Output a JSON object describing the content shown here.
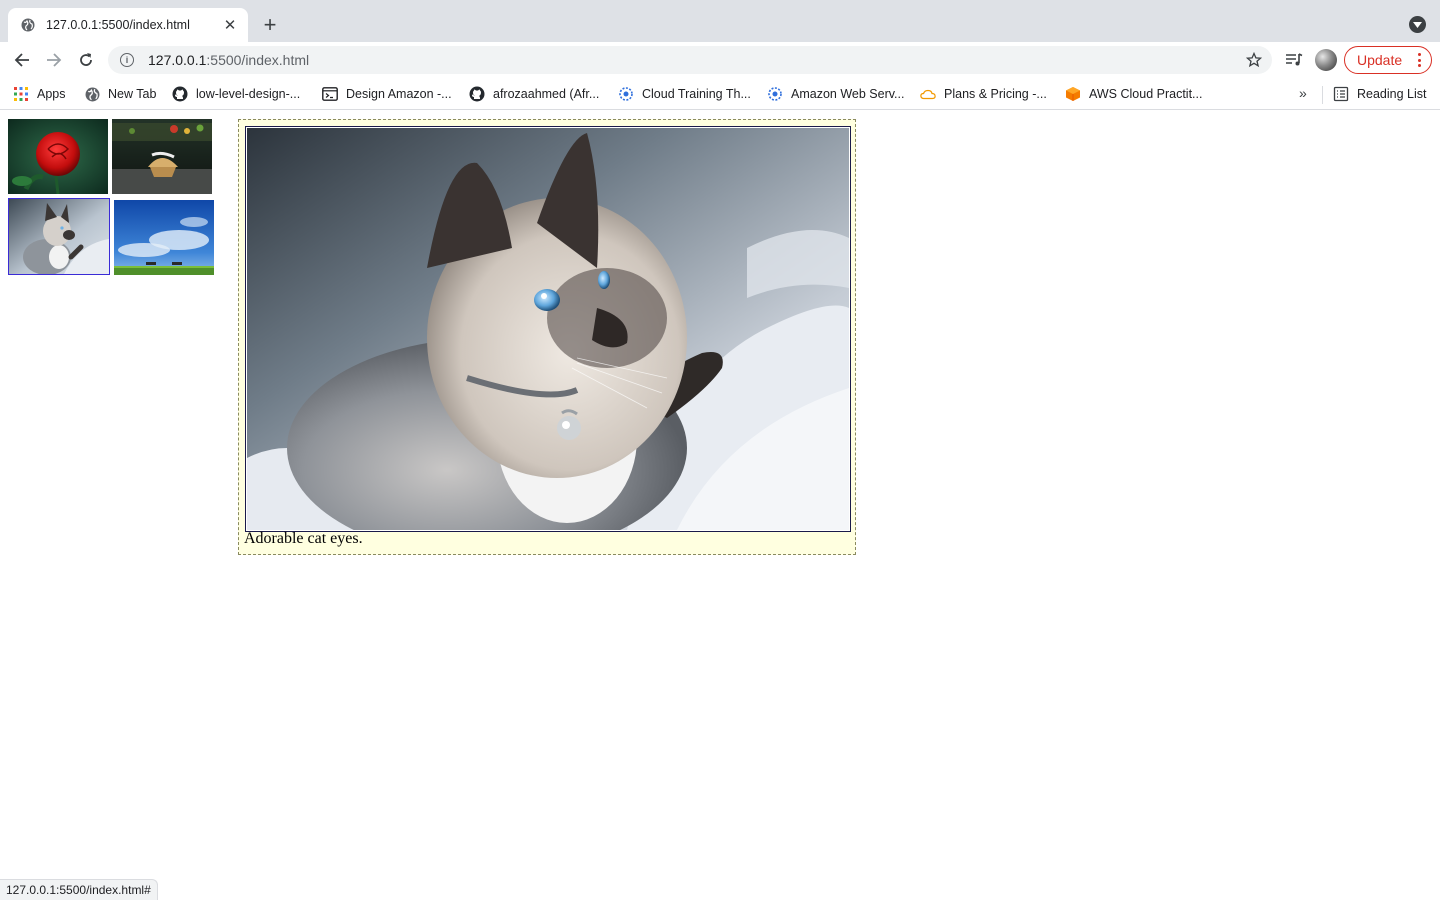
{
  "browser": {
    "tab": {
      "title": "127.0.0.1:5500/index.html"
    },
    "address": {
      "host": "127.0.0.1",
      "rest": ":5500/index.html"
    },
    "update_label": "Update",
    "bookmarks": [
      {
        "label": "Apps",
        "icon": "apps-grid-icon"
      },
      {
        "label": "New Tab",
        "icon": "globe-icon"
      },
      {
        "label": "low-level-design-...",
        "icon": "github-icon"
      },
      {
        "label": "Design Amazon -...",
        "icon": "terminal-icon"
      },
      {
        "label": "afrozaahmed (Afr...",
        "icon": "github-icon"
      },
      {
        "label": "Cloud Training Th...",
        "icon": "gear-icon"
      },
      {
        "label": "Amazon Web Serv...",
        "icon": "gear-icon"
      },
      {
        "label": "Plans & Pricing -...",
        "icon": "cloud-icon"
      },
      {
        "label": "AWS Cloud Practit...",
        "icon": "cube-icon"
      }
    ],
    "reading_list": "Reading List",
    "status_url": "127.0.0.1:5500/index.html#"
  },
  "gallery": {
    "thumbnails": [
      {
        "subject": "rose",
        "selected": false
      },
      {
        "subject": "food",
        "selected": false
      },
      {
        "subject": "cat",
        "selected": true
      },
      {
        "subject": "sky",
        "selected": false
      }
    ],
    "caption": "Adorable cat eyes."
  },
  "colors": {
    "accent_red": "#d93025",
    "figure_bg": "#ffffe0",
    "selected_border": "#3a2bd6"
  }
}
